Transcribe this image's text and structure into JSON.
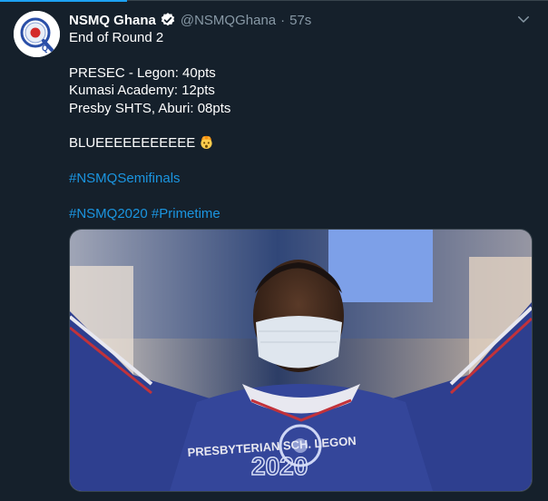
{
  "tweet": {
    "author_name": "NSMQ Ghana",
    "handle": "@NSMQGhana",
    "separator": "·",
    "time": "57s",
    "lines": {
      "title": "End of Round 2",
      "score1": "PRESEC - Legon: 40pts",
      "score2": "Kumasi Academy: 12pts",
      "score3": "Presby SHTS, Aburi: 08pts",
      "cheer": "BLUEEEEEEEEEEE"
    },
    "hashtags": {
      "semifinals": "#NSMQSemifinals",
      "nsmq2020": "#NSMQ2020",
      "primetime": "#Primetime"
    },
    "media": {
      "shirt_text": "PRESBYTERIAN SCH. LEGON",
      "watermark_year": "2020"
    }
  },
  "icons": {
    "verified": "verified-badge-icon",
    "caret": "chevron-down-icon",
    "emoji": "exploding-head-emoji"
  },
  "colors": {
    "background": "#15202b",
    "text": "#ffffff",
    "secondary": "#8899a6",
    "link": "#1b95e0",
    "accent": "#1da1f2"
  }
}
